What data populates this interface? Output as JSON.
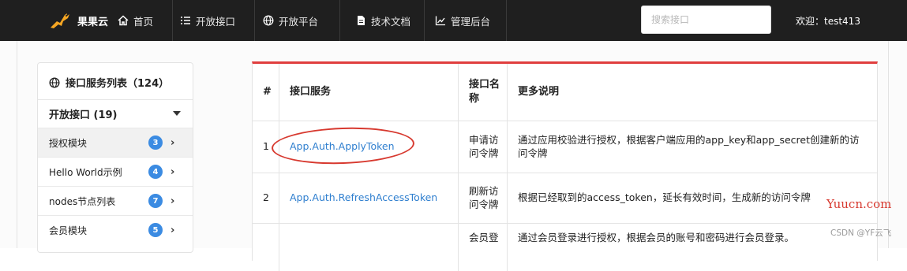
{
  "navbar": {
    "brand": "果果云",
    "items": [
      {
        "label": "首页",
        "icon": "home-icon"
      },
      {
        "label": "开放接口",
        "icon": "list-icon"
      },
      {
        "label": "开放平台",
        "icon": "globe-icon"
      },
      {
        "label": "技术文档",
        "icon": "document-icon"
      },
      {
        "label": "管理后台",
        "icon": "chart-icon"
      }
    ],
    "search_placeholder": "搜索接口",
    "search_value": "",
    "welcome": "欢迎：test413"
  },
  "sidebar": {
    "title": "接口服务列表（124）",
    "section": "开放接口 (19)",
    "items": [
      {
        "label": "授权模块",
        "count": "3"
      },
      {
        "label": "Hello World示例",
        "count": "4"
      },
      {
        "label": "nodes节点列表",
        "count": "7"
      },
      {
        "label": "会员模块",
        "count": "5"
      }
    ]
  },
  "table": {
    "headers": [
      "#",
      "接口服务",
      "接口名称",
      "更多说明"
    ],
    "rows": [
      {
        "index": "1",
        "service": "App.Auth.ApplyToken",
        "name": "申请访问令牌",
        "desc": "通过应用校验进行授权，根据客户端应用的app_key和app_secret创建新的访问令牌"
      },
      {
        "index": "2",
        "service": "App.Auth.RefreshAccessToken",
        "name": "刷新访问令牌",
        "desc": "根据已经取到的access_token，延长有效时间，生成新的访问令牌"
      },
      {
        "index": "",
        "service": "",
        "name": "会员登",
        "desc": "通过会员登录进行授权，根据会员的账号和密码进行会员登录。"
      }
    ]
  },
  "watermark": "Yuucn.com",
  "watermark_small": "CSDN @YF云飞",
  "colors": {
    "navbar": "#1f1f1f",
    "accent": "#e03e3e",
    "link": "#2f7fcf",
    "badge": "#3b8be2"
  }
}
